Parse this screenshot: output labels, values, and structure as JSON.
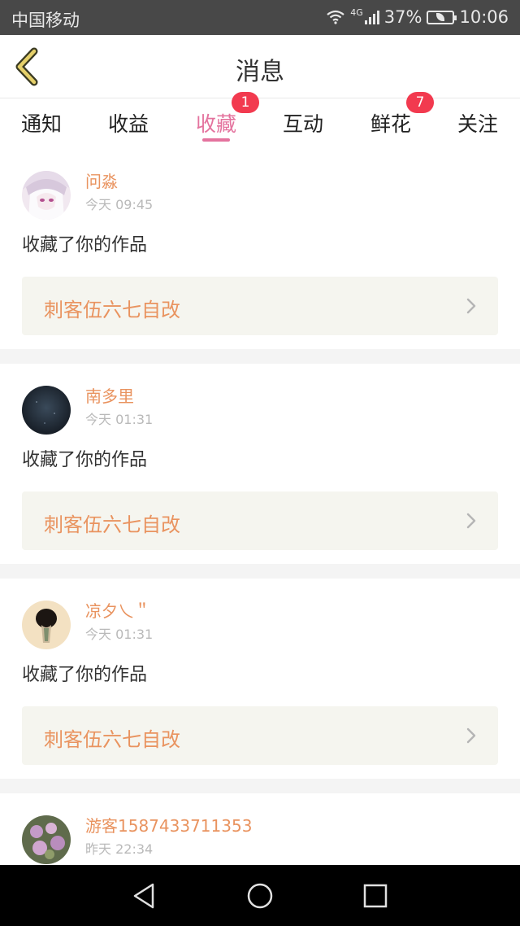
{
  "status_bar": {
    "carrier": "中国移动",
    "network": "4G",
    "battery": "37%",
    "time": "10:06"
  },
  "header": {
    "title": "消息"
  },
  "tabs": [
    {
      "label": "通知",
      "active": false,
      "badge": ""
    },
    {
      "label": "收益",
      "active": false,
      "badge": ""
    },
    {
      "label": "收藏",
      "active": true,
      "badge": "1"
    },
    {
      "label": "互动",
      "active": false,
      "badge": ""
    },
    {
      "label": "鲜花",
      "active": false,
      "badge": "7"
    },
    {
      "label": "关注",
      "active": false,
      "badge": ""
    }
  ],
  "messages": [
    {
      "username": "问淼",
      "time": "今天 09:45",
      "action": "收藏了你的作品",
      "work_title": "刺客伍六七自改"
    },
    {
      "username": "南多里",
      "time": "今天 01:31",
      "action": "收藏了你的作品",
      "work_title": "刺客伍六七自改"
    },
    {
      "username": "凉夕乀＂",
      "time": "今天 01:31",
      "action": "收藏了你的作品",
      "work_title": "刺客伍六七自改"
    },
    {
      "username": "游客1587433711353",
      "time": "昨天 22:34"
    }
  ],
  "colors": {
    "accent": "#e4739e",
    "username": "#e9935f",
    "badge": "#f23a4f",
    "statusbar": "#484848"
  }
}
